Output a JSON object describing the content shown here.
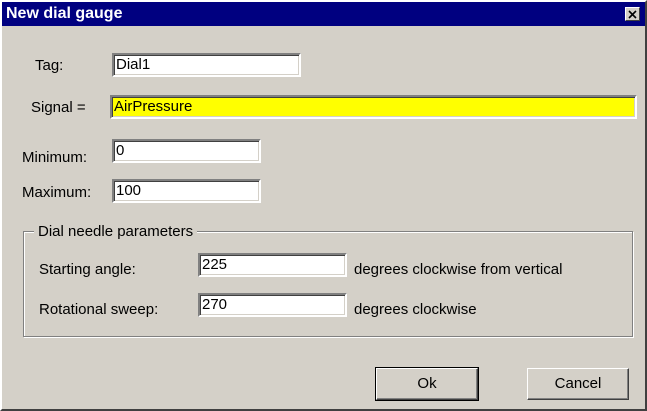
{
  "window": {
    "title": "New dial gauge",
    "close_icon": "close-icon"
  },
  "form": {
    "tag": {
      "label": "Tag:",
      "value": "Dial1"
    },
    "signal": {
      "label": "Signal =",
      "value": "AirPressure",
      "highlight_color": "#ffff00"
    },
    "minimum": {
      "label": "Minimum:",
      "value": "0"
    },
    "maximum": {
      "label": "Maximum:",
      "value": "100"
    }
  },
  "needle": {
    "title": "Dial needle parameters",
    "starting_angle": {
      "label": "Starting angle:",
      "value": "225",
      "unit": "degrees clockwise from vertical"
    },
    "rotational_sweep": {
      "label": "Rotational sweep:",
      "value": "270",
      "unit": "degrees clockwise"
    }
  },
  "buttons": {
    "ok": "Ok",
    "cancel": "Cancel"
  },
  "colors": {
    "title_bar": "#000080",
    "dialog_face": "#d4d0c8"
  }
}
